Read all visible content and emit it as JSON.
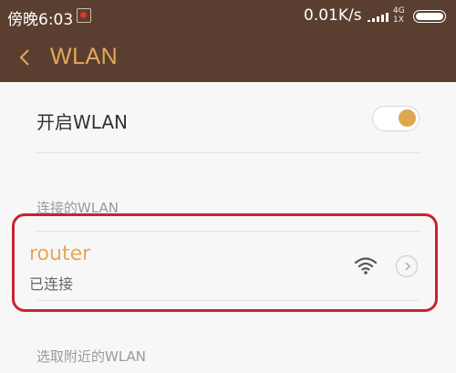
{
  "status_bar": {
    "time": "傍晚6:03",
    "net_speed": "0.01K/s",
    "net_type_top": "4G",
    "net_type_bottom": "1X"
  },
  "header": {
    "title": "WLAN"
  },
  "toggle_row": {
    "label": "开启WLAN",
    "enabled": true
  },
  "sections": {
    "connected_header": "连接的WLAN",
    "nearby_header": "选取附近的WLAN"
  },
  "connected_network": {
    "name": "router",
    "status": "已连接"
  },
  "colors": {
    "header_bg": "#5a3f30",
    "accent": "#e4a85a",
    "toggle_knob": "#e0a550",
    "highlight": "#c8232e"
  }
}
